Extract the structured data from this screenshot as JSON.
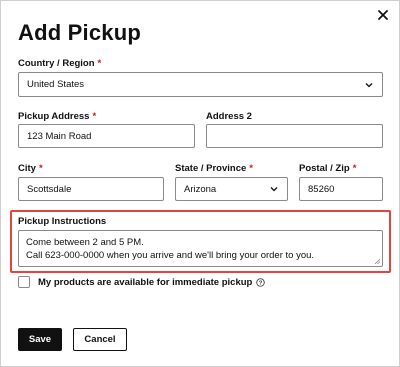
{
  "dialog": {
    "title": "Add Pickup"
  },
  "form": {
    "country": {
      "label": "Country / Region",
      "value": "United States"
    },
    "pickup_address": {
      "label": "Pickup Address",
      "value": "123 Main Road"
    },
    "address2": {
      "label": "Address 2",
      "value": ""
    },
    "city": {
      "label": "City",
      "value": "Scottsdale"
    },
    "state": {
      "label": "State / Province",
      "value": "Arizona"
    },
    "zip": {
      "label": "Postal / Zip",
      "value": "85260"
    },
    "instructions": {
      "label": "Pickup Instructions",
      "line1": "Come between 2 and 5 PM.",
      "line2": "Call 623-000-0000 when you arrive and we'll bring your order to you."
    },
    "immediate_pickup": {
      "label": "My products are available for immediate pickup",
      "checked": false
    }
  },
  "actions": {
    "save_label": "Save",
    "cancel_label": "Cancel"
  },
  "colors": {
    "highlight": "#e2453c",
    "required": "#dd1111",
    "primary_button": "#111111"
  },
  "icons": {
    "close": "close-icon",
    "chevron": "chevron-down-icon",
    "info": "info-icon"
  }
}
